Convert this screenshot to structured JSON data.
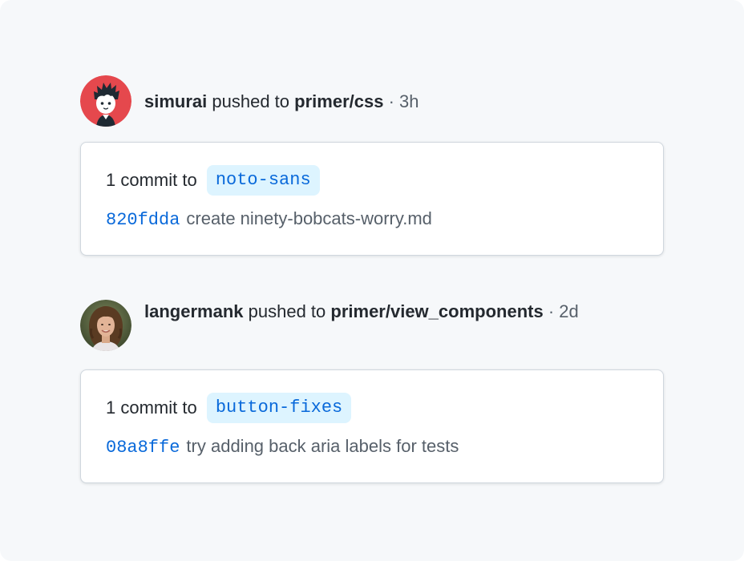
{
  "colors": {
    "background": "#f6f8fa",
    "card_background": "#ffffff",
    "link_blue": "#0969da",
    "branch_bg": "#ddf4ff",
    "text_primary": "#24292f",
    "text_secondary": "#57606a",
    "avatar_red": "#e5484d"
  },
  "events": [
    {
      "actor": "simurai",
      "verb": "pushed to",
      "repo": "primer/css",
      "separator": "·",
      "time": "3h",
      "avatar_icon": "cartoon-avatar-icon",
      "summary_text": "1 commit to",
      "branch": "noto-sans",
      "commit_sha": "820fdda",
      "commit_message": "create ninety-bobcats-worry.md"
    },
    {
      "actor": "langermank",
      "verb": "pushed to",
      "repo": "primer/view_components",
      "separator": "·",
      "time": "2d",
      "avatar_icon": "person-photo-icon",
      "summary_text": "1 commit to",
      "branch": "button-fixes",
      "commit_sha": "08a8ffe",
      "commit_message": "try adding back aria labels for tests"
    }
  ]
}
